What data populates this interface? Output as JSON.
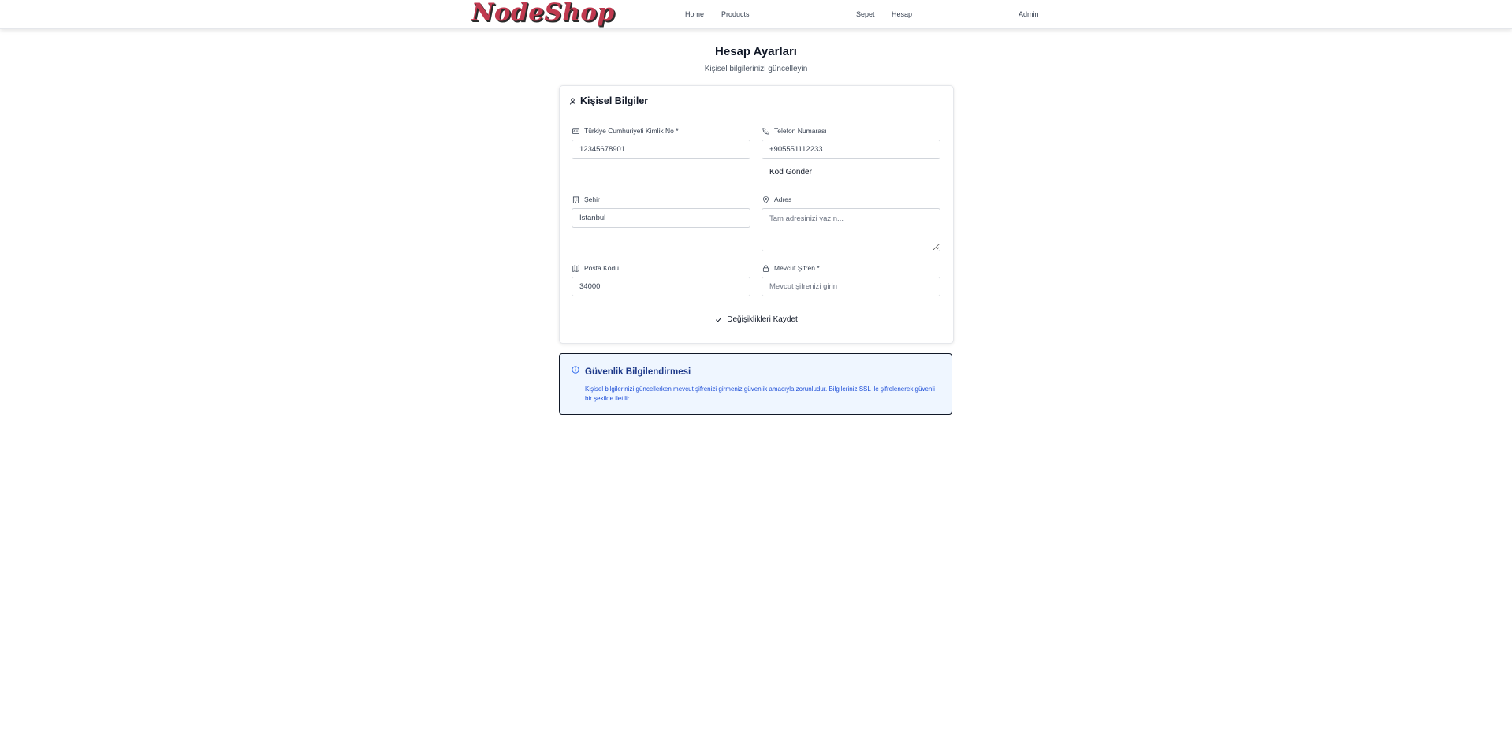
{
  "nav": {
    "logo": "NodeShop",
    "links": [
      "Home",
      "Products",
      "Sepet",
      "Hesap",
      "Admin"
    ]
  },
  "page": {
    "title": "Hesap Ayarları",
    "subtitle": "Kişisel bilgilerinizi güncelleyin"
  },
  "personal": {
    "title": "Kişisel Bilgiler",
    "tc_label": "Türkiye Cumhuriyeti Kimlik No *",
    "tc_value": "12345678901",
    "phone_label": "Telefon Numarası",
    "phone_value": "+905551112233",
    "send_code": "Kod Gönder",
    "city_label": "Şehir",
    "city_value": "İstanbul",
    "address_label": "Adres",
    "address_placeholder": "Tam adresinizi yazın...",
    "zip_label": "Posta Kodu",
    "zip_value": "34000",
    "password_label": "Mevcut Şifren *",
    "password_placeholder": "Mevcut şifrenizi girin",
    "save_label": "Değişiklikleri Kaydet"
  },
  "security": {
    "title": "Güvenlik Bilgilendirmesi",
    "text": "Kişisel bilgilerinizi güncellerken mevcut şifrenizi girmeniz güvenlik amacıyla zorunludur. Bilgileriniz SSL ile şifrelenerek güvenli bir şekilde iletilir."
  },
  "colors": {
    "logo": "#c0394f",
    "info_bg": "#eff6ff",
    "info_text": "#1d4ed8"
  }
}
